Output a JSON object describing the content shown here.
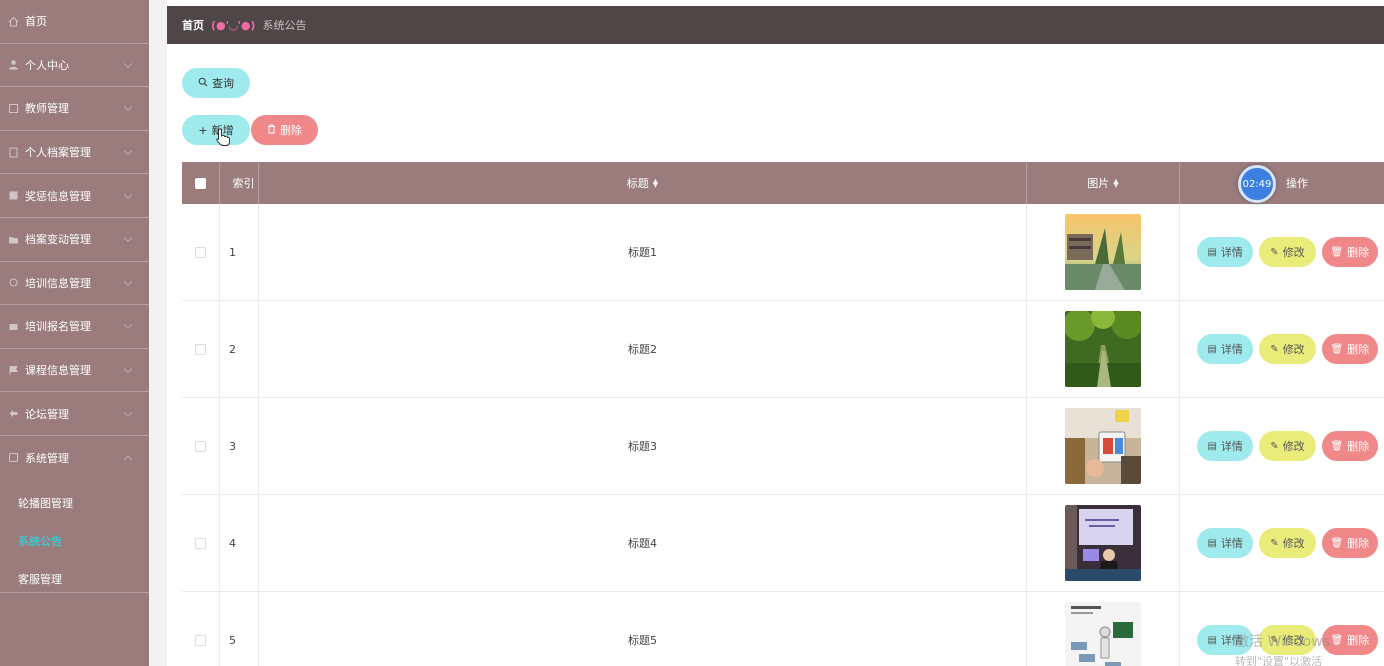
{
  "sidebar": {
    "items": [
      {
        "label": "首页",
        "icon": "home-icon",
        "expandable": false
      },
      {
        "label": "个人中心",
        "icon": "user-icon",
        "expandable": true
      },
      {
        "label": "教师管理",
        "icon": "teacher-icon",
        "expandable": true
      },
      {
        "label": "个人档案管理",
        "icon": "file-icon",
        "expandable": true
      },
      {
        "label": "奖惩信息管理",
        "icon": "award-icon",
        "expandable": true
      },
      {
        "label": "档案变动管理",
        "icon": "folder-icon",
        "expandable": true
      },
      {
        "label": "培训信息管理",
        "icon": "info-icon",
        "expandable": true
      },
      {
        "label": "培训报名管理",
        "icon": "signup-icon",
        "expandable": true
      },
      {
        "label": "课程信息管理",
        "icon": "book-icon",
        "expandable": true
      },
      {
        "label": "论坛管理",
        "icon": "forum-icon",
        "expandable": true
      },
      {
        "label": "系统管理",
        "icon": "system-icon",
        "expandable": true
      }
    ],
    "submenu": [
      {
        "label": "轮播图管理",
        "active": false
      },
      {
        "label": "系统公告",
        "active": true
      },
      {
        "label": "客服管理",
        "active": false
      }
    ]
  },
  "breadcrumb": {
    "home": "首页",
    "face": "(●'◡'●)",
    "current": "系统公告"
  },
  "toolbar": {
    "search_label": "查询",
    "add_label": "新增",
    "delete_label": "删除"
  },
  "table": {
    "headers": {
      "index": "索引",
      "title": "标题",
      "image": "图片",
      "actions": "操作"
    },
    "rows": [
      {
        "index": "1",
        "title": "标题1"
      },
      {
        "index": "2",
        "title": "标题2"
      },
      {
        "index": "3",
        "title": "标题3"
      },
      {
        "index": "4",
        "title": "标题4"
      },
      {
        "index": "5",
        "title": "标题5"
      }
    ],
    "action_labels": {
      "detail": "详情",
      "edit": "修改",
      "delete": "删除"
    }
  },
  "timer": "02:49",
  "watermark": {
    "line1": "激活 Windows",
    "line2": "转到\"设置\"以激活 Windows。"
  },
  "colors": {
    "sidebar": "#9a7c7d",
    "header": "#4e4647",
    "cyan": "#9eeaec",
    "yellow": "#eaec7a",
    "red": "#f0888a",
    "active_sub": "#3ec4d0"
  }
}
